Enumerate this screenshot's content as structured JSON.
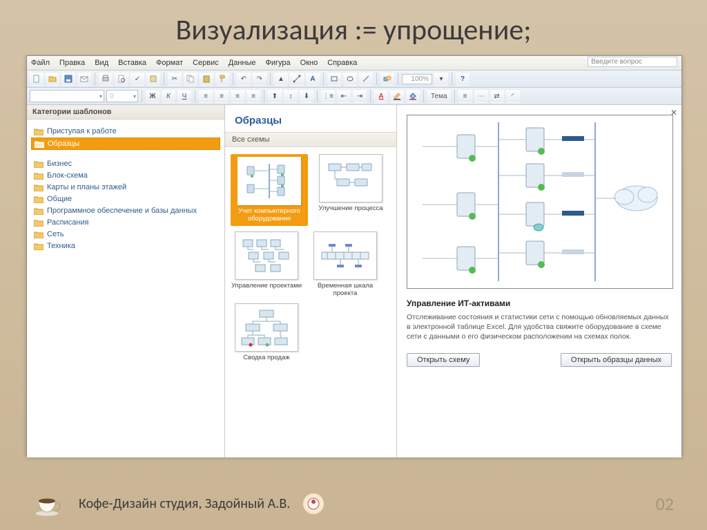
{
  "slide": {
    "title": "Визуализация := упрощение;",
    "footer_text": "Кофе-Дизайн студия, Задойный А.В.",
    "page_number": "02"
  },
  "menubar": {
    "items": [
      "Файл",
      "Правка",
      "Вид",
      "Вставка",
      "Формат",
      "Сервис",
      "Данные",
      "Фигура",
      "Окно",
      "Справка"
    ],
    "help_placeholder": "Введите вопрос"
  },
  "toolbar1": {
    "zoom": "100%"
  },
  "toolbar2": {
    "font_name": "",
    "font_size": "0",
    "theme_label": "Тема"
  },
  "sidebar": {
    "header": "Категории шаблонов",
    "top_items": [
      {
        "label": "Приступая к работе",
        "selected": false
      },
      {
        "label": "Образцы",
        "selected": true
      }
    ],
    "items": [
      {
        "label": "Бизнес"
      },
      {
        "label": "Блок-схема"
      },
      {
        "label": "Карты и планы этажей"
      },
      {
        "label": "Общие"
      },
      {
        "label": "Программное обеспечение и базы данных"
      },
      {
        "label": "Расписания"
      },
      {
        "label": "Сеть"
      },
      {
        "label": "Техника"
      }
    ]
  },
  "gallery": {
    "title": "Образцы",
    "section": "Все схемы",
    "templates": [
      {
        "label": "Учет компьютерного оборудования",
        "selected": true
      },
      {
        "label": "Улучшение процесса",
        "selected": false
      },
      {
        "label": "Управление проектами",
        "selected": false
      },
      {
        "label": "Временная шкала проекта",
        "selected": false
      },
      {
        "label": "Сводка продаж",
        "selected": false
      }
    ]
  },
  "preview": {
    "title": "Управление ИТ-активами",
    "description": "Отслеживание состояния и статистики сети с помощью обновляемых данных в электронной таблице Excel. Для удобства свяжите оборудование в схеме сети с данными о его физическом расположении на схемах полок.",
    "open_btn": "Открыть схему",
    "open_data_btn": "Открыть образцы данных"
  }
}
